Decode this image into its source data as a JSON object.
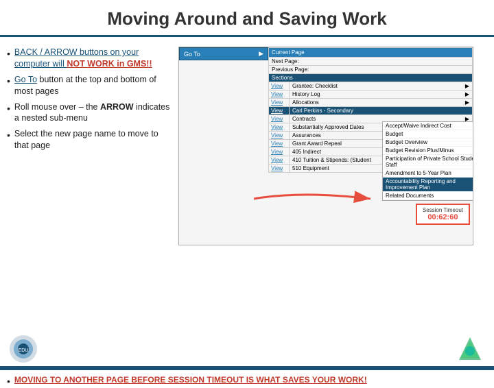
{
  "title": "Moving Around and Saving Work",
  "bullets": [
    {
      "id": "bullet1",
      "text_plain": "BACK / ARROW buttons on your computer will NOT WORK in GMS!!",
      "parts": [
        {
          "type": "underline",
          "text": "BACK / ARROW buttons on your computer will "
        },
        {
          "type": "bold-red",
          "text": "NOT WORK in GMS!!"
        }
      ]
    },
    {
      "id": "bullet2",
      "text": "Go To button at the top and bottom of most pages",
      "underline_part": "Go To"
    },
    {
      "id": "bullet3",
      "text": "Roll mouse over – the ARROW indicates a nested sub-menu",
      "bold_parts": [
        "ARROW"
      ]
    },
    {
      "id": "bullet4",
      "text": "Select the new page name to move to that page"
    },
    {
      "id": "bullet5",
      "text": "MOVING TO ANOTHER PAGE BEFORE SESSION TIMEOUT IS WHAT SAVES YOUR WORK!",
      "all_bold_underline": true
    }
  ],
  "gms": {
    "goto_button": "Go To",
    "goto_arrow": "▶",
    "dropdown": {
      "items": [
        {
          "label": "Current Page",
          "type": "normal"
        },
        {
          "label": "Next Page",
          "type": "normal"
        },
        {
          "label": "Previous Page",
          "type": "normal"
        },
        {
          "label": "Sections",
          "type": "section-header"
        },
        {
          "label": "Grantee: Checklist",
          "type": "arrow"
        },
        {
          "label": "History Log",
          "type": "arrow"
        },
        {
          "label": "Allocations",
          "type": "arrow"
        },
        {
          "label": "Carl Perkins - Secondary",
          "type": "blue"
        },
        {
          "label": "Contracts",
          "type": "arrow"
        },
        {
          "label": "Substantially Approved Dates",
          "type": "arrow"
        },
        {
          "label": "Assurances",
          "type": "arrow"
        },
        {
          "label": "Grant Award Repeal",
          "type": "arrow"
        },
        {
          "label": "405  Indirect",
          "type": "normal"
        },
        {
          "label": "410  Tuition & Stipends: (Student",
          "type": "normal"
        },
        {
          "label": "510  Equipment",
          "type": "normal"
        }
      ]
    },
    "sub_menu": {
      "items": [
        {
          "label": "Accept/Waive Indirect Cost",
          "type": "normal"
        },
        {
          "label": "Budget",
          "type": "normal"
        },
        {
          "label": "Budget Overview",
          "type": "normal"
        },
        {
          "label": "Budget Revision Plus/Minus",
          "type": "normal"
        },
        {
          "label": "Participation of Private School Students or Staff",
          "type": "normal"
        },
        {
          "label": "Amendment to 5-Year Plan",
          "type": "normal"
        },
        {
          "label": "Accountability Reporting and Improvement Plan",
          "type": "highlighted"
        },
        {
          "label": "Related Documents",
          "type": "normal"
        }
      ]
    },
    "view_links": [
      "View",
      "View",
      "View",
      "View",
      "View",
      "View",
      "View",
      "View",
      "View",
      "View"
    ]
  },
  "session": {
    "label": "Session Timeout",
    "time": "00:62:60"
  },
  "colors": {
    "accent": "#1a5276",
    "red": "#c0392b",
    "blue_btn": "#2980b9"
  }
}
